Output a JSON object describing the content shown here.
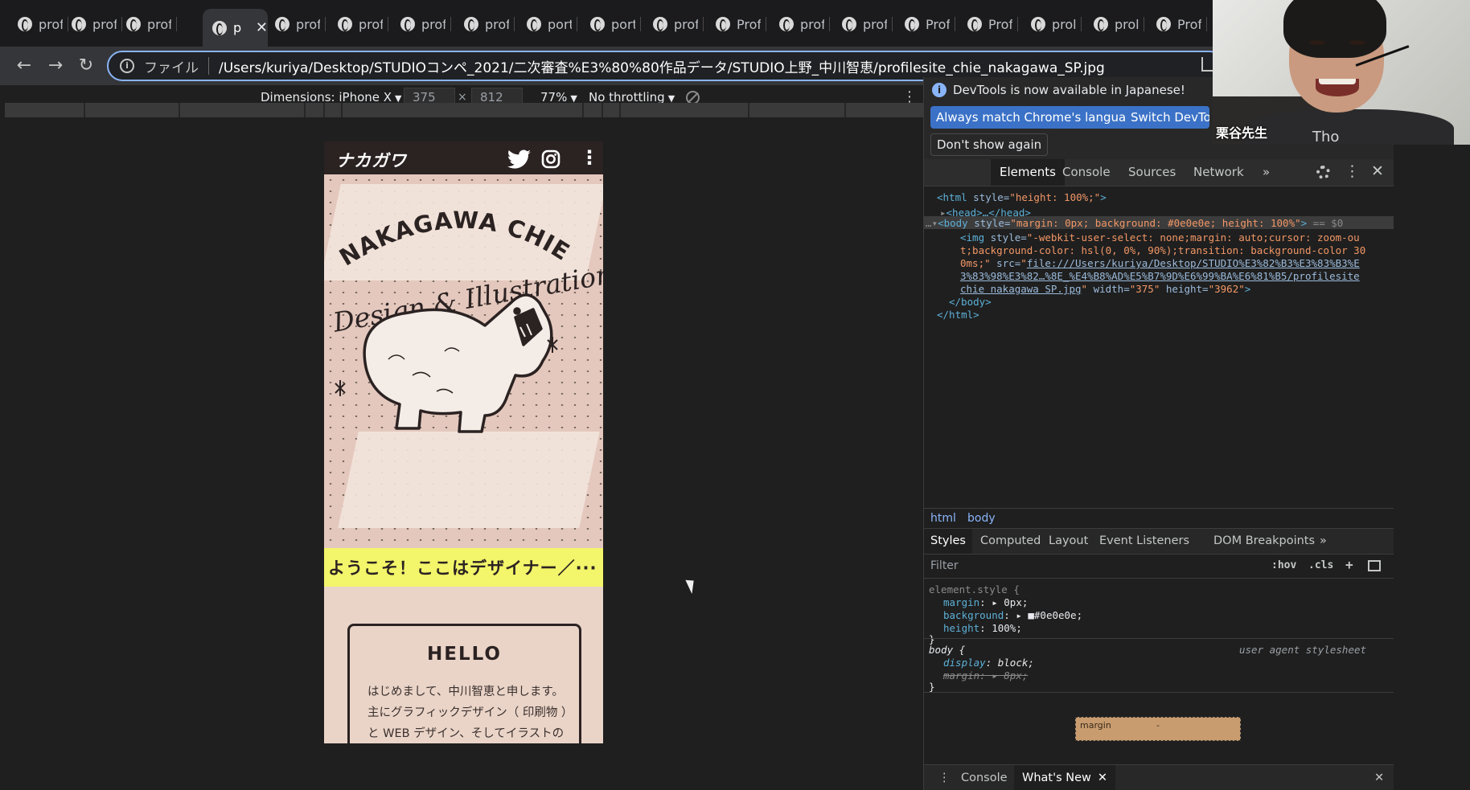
{
  "browser": {
    "tabs": [
      {
        "title": "profi"
      },
      {
        "title": "profi"
      },
      {
        "title": "profi"
      },
      {
        "title": "p",
        "active": true
      },
      {
        "title": "profi"
      },
      {
        "title": "profi"
      },
      {
        "title": "profi"
      },
      {
        "title": "profi"
      },
      {
        "title": "port"
      },
      {
        "title": "port"
      },
      {
        "title": "prof"
      },
      {
        "title": "Prof"
      },
      {
        "title": "prof"
      },
      {
        "title": "prof"
      },
      {
        "title": "Prof"
      },
      {
        "title": "Prof"
      },
      {
        "title": "proli"
      },
      {
        "title": "proli"
      },
      {
        "title": "Prof"
      }
    ],
    "omnibox": {
      "scheme": "ファイル",
      "url": "/Users/kuriya/Desktop/STUDIOコンペ_2021/二次審査%E3%80%80作品データ/STUDIO上野_中川智恵/profilesite_chie_nakagawa_SP.jpg"
    }
  },
  "device_toolbar": {
    "dimensions_label": "Dimensions: iPhone X",
    "width": "375",
    "times": "×",
    "height": "812",
    "zoom": "77%",
    "throttling": "No throttling"
  },
  "site": {
    "logo": "ナカガワ",
    "hero_title": "NAKAGAWA CHIE",
    "hero_script": "Design & Illustration",
    "banner": "ようこそ！ここはデザイナー／···",
    "hello_title": "HELLO",
    "hello_lines": [
      "はじめまして、中川智恵と申します。",
      "主にグラフィックデザイン（ 印刷物 ）",
      "と WEB デザイン、そしてイラストの"
    ]
  },
  "devtools": {
    "info": {
      "message": "DevTools is now available in Japanese!",
      "btn_match": "Always match Chrome's language",
      "btn_switch": "Switch DevTool",
      "btn_dont": "Don't show again"
    },
    "tabs": [
      "Elements",
      "Console",
      "Sources",
      "Network"
    ],
    "more": "»",
    "dom": {
      "l1_tag": "<html",
      "l1_attr": " style=",
      "l1_val": "\"height: 100%;\"",
      "l1_end": ">",
      "l2": "<head>…</head>",
      "l3_tag": "<body",
      "l3_attr": " style=",
      "l3_val": "\"margin: 0px; background: #0e0e0e; height: 100%\"",
      "l3_end": ">",
      "l3_sel": " == $0",
      "img_tag": "<img",
      "img_style_attr": " style=",
      "img_style1": "\"-webkit-user-select: none;margin: auto;cursor: zoom-ou",
      "img_style2": "t;background-color: hsl(0, 0%, 90%);transition: background-color 30",
      "img_style3": "0ms;\"",
      "img_src_attr": " src=",
      "img_src1": "file:///Users/kuriya/Desktop/STUDIO%E3%82%B3%E3%83%B3%E",
      "img_src2": "3%83%98%E3%82…%8E_%E4%B8%AD%E5%B7%9D%E6%99%BA%E6%81%B5/profilesite",
      "img_src3": "chie nakagawa SP.jpg",
      "img_width_attr": " width=",
      "img_width": "\"375\"",
      "img_height_attr": " height=",
      "img_height": "\"3962\"",
      "img_end": ">",
      "l5": "</body>",
      "l6": "</html>"
    },
    "crumbs": [
      "html",
      "body"
    ],
    "style_tabs": [
      "Styles",
      "Computed",
      "Layout",
      "Event Listeners",
      "DOM Breakpoints"
    ],
    "filter_placeholder": "Filter",
    "hov": ":hov",
    "cls": ".cls",
    "plus": "+",
    "styles": {
      "el_sel": "element.style {",
      "p1": "margin",
      "v1": "▸ 0px;",
      "p2": "background",
      "v2": "▸ ■#0e0e0e;",
      "p3": "height",
      "v3": "100%;",
      "close": "}",
      "body_sel": "body {",
      "ua": "user agent stylesheet",
      "p4": "display",
      "v4": "block;",
      "p5": "margin: ▸ 8px;"
    },
    "box_label": "margin",
    "box_dash": "-",
    "drawer": [
      "Console",
      "What's New"
    ]
  },
  "webcam": {
    "name": "栗谷先生",
    "sign": "Tho"
  }
}
